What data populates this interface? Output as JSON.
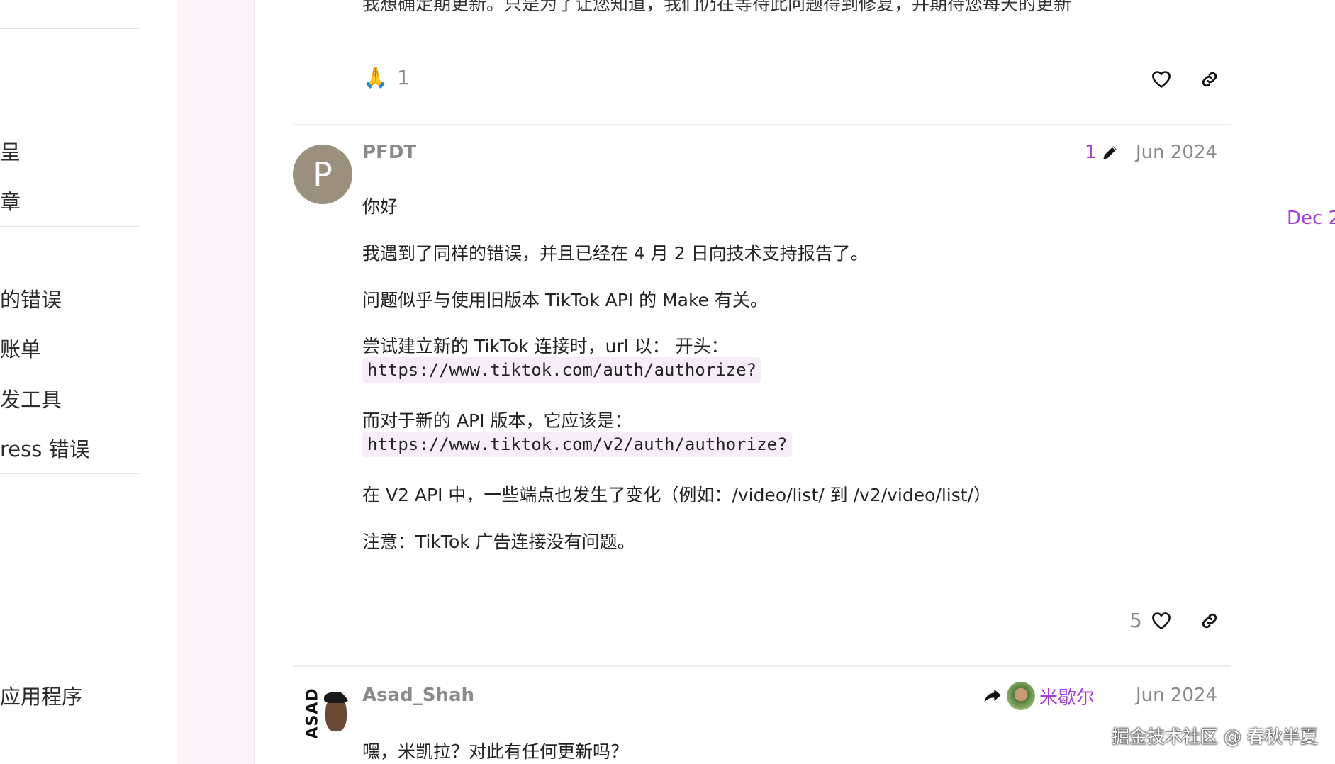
{
  "sidebar": {
    "items": [
      {
        "label": "呈"
      },
      {
        "label": "章"
      },
      {
        "label": "的错误"
      },
      {
        "label": "账单"
      },
      {
        "label": "发工具"
      },
      {
        "label": "ress 错误"
      },
      {
        "label": "应用程序"
      }
    ]
  },
  "timeline": {
    "date": "Dec 2"
  },
  "top_post": {
    "partial_text": "我想确定期更新。只是为了让您知道，我们仍在等待此问题得到修复，并期待您每天的更新",
    "reaction_emoji": "🙏",
    "reaction_count": "1"
  },
  "post_pfdt": {
    "avatar_letter": "P",
    "username": "PFDT",
    "edit_count": "1",
    "date": "Jun 2024",
    "paragraphs": {
      "p1": "你好",
      "p2": "我遇到了同样的错误，并且已经在 4 月 2 日向技术支持报告了。",
      "p3": "问题似乎与使用旧版本 TikTok API 的 Make 有关。",
      "p4": "尝试建立新的 TikTok 连接时，url 以： 开头：",
      "code1": "https://www.tiktok.com/auth/authorize?",
      "p5": "而对于新的 API 版本，它应该是：",
      "code2": "https://www.tiktok.com/v2/auth/authorize?",
      "p6": "在 V2 API 中，一些端点也发生了变化（例如：/video/list/ 到 /v2/video/list/）",
      "p7": "注意：TikTok 广告连接没有问题。"
    },
    "like_count": "5"
  },
  "post_asad": {
    "avatar_text": "ASAD",
    "username": "Asad_Shah",
    "reply_to": "米歇尔",
    "date": "Jun 2024",
    "text": "嘿，米凯拉？对此有任何更新吗？"
  },
  "watermark": "掘金技术社区 @ 春秋半夏",
  "colors": {
    "accent": "#a53edb",
    "code_bg": "#f6edf8",
    "avatar_p": "#9b8f7e"
  }
}
